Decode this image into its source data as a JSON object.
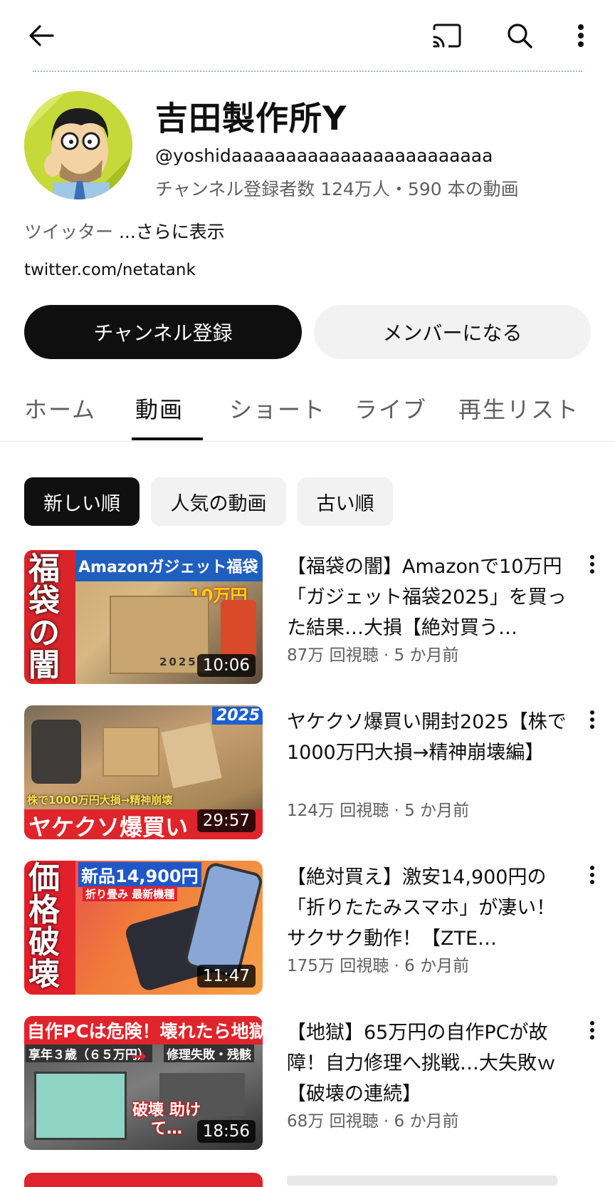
{
  "topbar": {
    "back_icon": "arrow-left-icon",
    "cast_icon": "cast-icon",
    "search_icon": "search-icon",
    "more_icon": "more-vert-icon"
  },
  "channel": {
    "name": "吉田製作所Y",
    "handle": "@yoshidaaaaaaaaaaaaaaaaaaaaaaaa",
    "stats": "チャンネル登録者数 124万人・590 本の動画",
    "description_prefix": "ツイッター ",
    "description_more": "...さらに表示",
    "link": "twitter.com/netatank",
    "subscribe_label": "チャンネル登録",
    "member_label": "メンバーになる"
  },
  "tabs": [
    {
      "label": "ホーム"
    },
    {
      "label": "動画"
    },
    {
      "label": "ショート"
    },
    {
      "label": "ライブ"
    },
    {
      "label": "再生リスト"
    }
  ],
  "chips": [
    {
      "label": "新しい順",
      "active": true
    },
    {
      "label": "人気の動画",
      "active": false
    },
    {
      "label": "古い順",
      "active": false
    }
  ],
  "videos": [
    {
      "title": "【福袋の闇】Amazonで10万円「ガジェット福袋2025」を買った結果…大損【絶対買う…",
      "meta": "87万 回視聴 · 5 か月前",
      "duration": "10:06",
      "thumb_text_a": "福袋の闇",
      "thumb_text_b": "Amazonガジェット福袋",
      "thumb_text_c": "10万円",
      "thumb_text_d": "2025"
    },
    {
      "title": "ヤケクソ爆買い開封2025【株で1000万円大損→精神崩壊編】",
      "meta": "124万 回視聴 · 5 か月前",
      "duration": "29:57",
      "thumb_text_a": "2025",
      "thumb_text_b": "株で1000万円大損→精神崩壊",
      "thumb_text_c": "ヤケクソ爆買い"
    },
    {
      "title": "【絶対買え】激安14,900円の「折りたたみスマホ」が凄い！サクサク動作！【ZTE…",
      "meta": "175万 回視聴 · 6 か月前",
      "duration": "11:47",
      "thumb_text_a": "価格破壊",
      "thumb_text_b": "新品14,900円",
      "thumb_text_c": "折り畳み 最新機種"
    },
    {
      "title": "【地獄】65万円の自作PCが故障！自力修理へ挑戦…大失敗ｗ【破壊の連続】",
      "meta": "68万 回視聴 · 6 か月前",
      "duration": "18:56",
      "thumb_text_a": "自作PCは危険！壊れたら地獄",
      "thumb_text_b": "享年３歳（６５万円）",
      "thumb_text_c": "修理失敗・残骸",
      "thumb_text_d": "破壊 助けて…"
    }
  ]
}
